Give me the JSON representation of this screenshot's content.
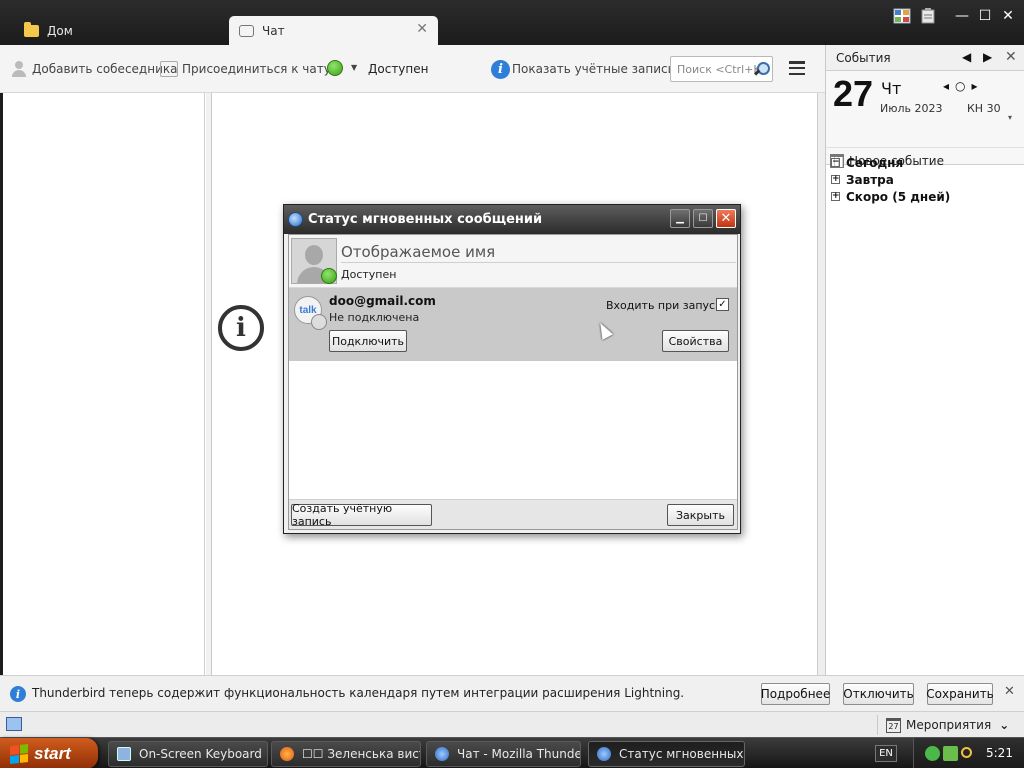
{
  "tabs": [
    {
      "label": "Дом",
      "icon": "folder-icon"
    },
    {
      "label": "Чат",
      "icon": "chat-bubble-icon",
      "active": true
    }
  ],
  "toolbar": {
    "add_contact": "Добавить собеседника",
    "join_chat": "Присоединиться к чату",
    "status": "Доступен",
    "status_color": "#3e9e17",
    "show_accounts": "Показать учётные записи",
    "search_placeholder": "Поиск <Ctrl+K>"
  },
  "events_pane": {
    "title": "События",
    "day_number": "27",
    "day_name": "Чт",
    "month_year": "Июль 2023",
    "week": "КН 30",
    "new_event": "Новое событие",
    "agenda": [
      {
        "label": "Сегодня",
        "expanded": true
      },
      {
        "label": "Завтра",
        "expanded": false
      },
      {
        "label": "Скоро (5 дней)",
        "expanded": false
      }
    ]
  },
  "notification": {
    "text": "Thunderbird теперь содержит функциональность календаря путем интеграции расширения Lightning.",
    "more_button": "Подробнее",
    "disable_button": "Отключить",
    "keep_button": "Сохранить"
  },
  "statusbar": {
    "events_label": "Мероприятия",
    "cal_day": "27"
  },
  "dialog": {
    "title": "Статус мгновенных сообщений",
    "display_name_placeholder": "Отображаемое имя",
    "status": "Доступен",
    "account": {
      "name": "doo@gmail.com",
      "state": "Не подключена",
      "autologin_label": "Входить при запуске",
      "autologin_checked": true,
      "connect_button": "Подключить",
      "properties_button": "Свойства"
    },
    "create_account_button": "Создать учётную запись",
    "close_button": "Закрыть"
  },
  "taskbar": {
    "start": "start",
    "tasks": [
      {
        "label": "On-Screen Keyboard",
        "icon": "keyboard-icon"
      },
      {
        "label": "☐☐ Зеленська вист…",
        "icon": "firefox-icon"
      },
      {
        "label": "Чат - Mozilla Thunder…",
        "icon": "thunderbird-icon"
      },
      {
        "label": "Статус мгновенных …",
        "icon": "thunderbird-icon",
        "active": true
      }
    ],
    "language": "EN",
    "clock": "5:21"
  }
}
